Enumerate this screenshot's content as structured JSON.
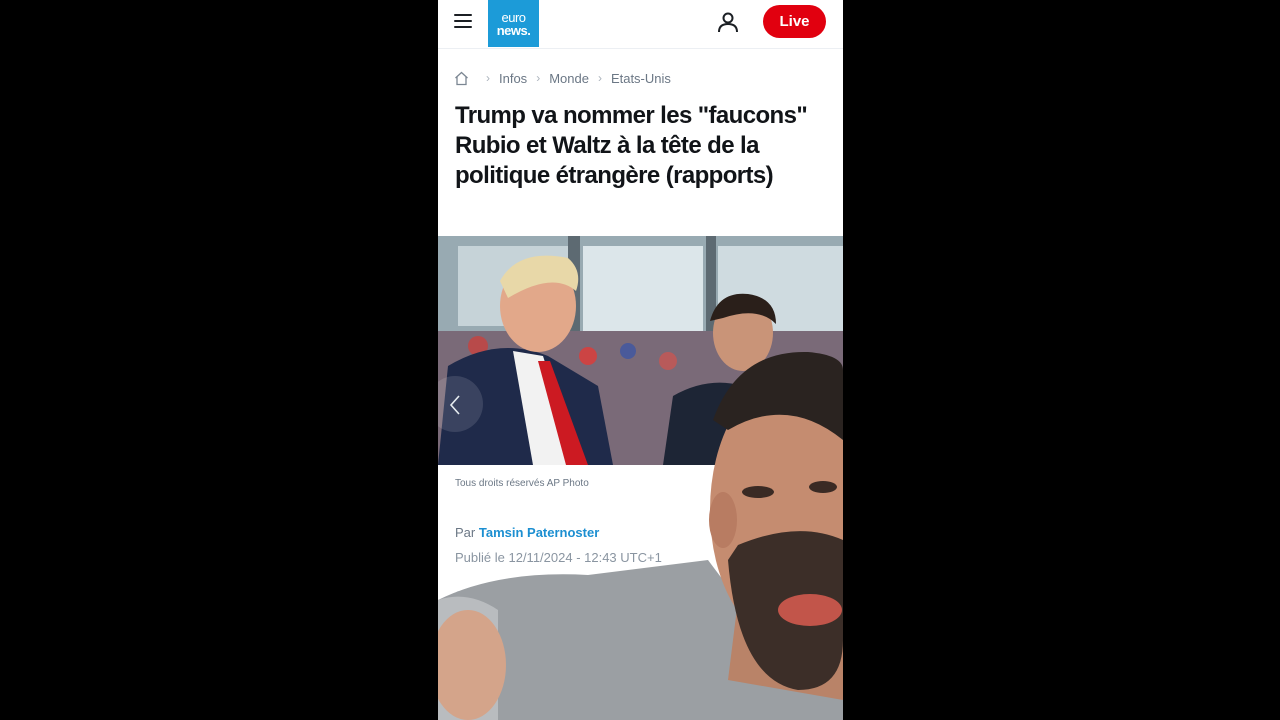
{
  "header": {
    "logo_line1": "euro",
    "logo_line2": "news.",
    "live_label": "Live",
    "brand_color": "#1c9bd8",
    "live_color": "#e1000f"
  },
  "breadcrumb": {
    "items": [
      "Infos",
      "Monde",
      "Etats-Unis"
    ]
  },
  "article": {
    "title": "Trump va nommer les \"faucons\" Rubio et Waltz à la tête de la politique étrangère (rapports)",
    "image_caption": "Tous droits réservés AP Photo",
    "byline_prefix": "Par",
    "author": "Tamsin Paternoster",
    "published": "Publié le 12/11/2024 - 12:43 UTC+1"
  },
  "icons": {
    "menu": "menu-icon",
    "user": "user-icon",
    "home": "home-icon",
    "share": "share-icon",
    "carousel_prev": "chevron-left-icon"
  }
}
